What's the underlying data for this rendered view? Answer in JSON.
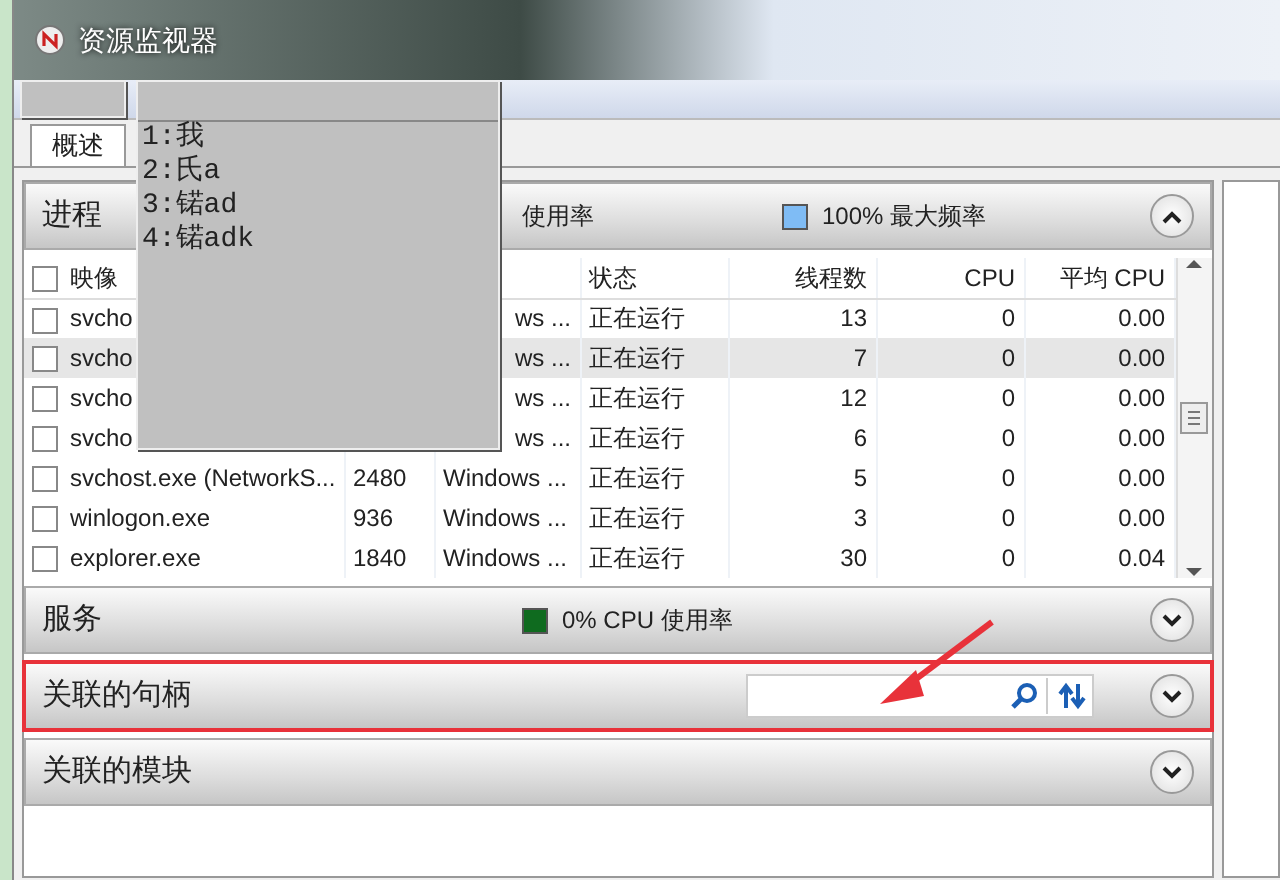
{
  "window": {
    "title": "资源监视器"
  },
  "tabs": [
    {
      "label": "概述",
      "selected": true
    }
  ],
  "ime_popup": {
    "candidates": [
      "1:我",
      "2:氏a",
      "3:锘ad",
      "4:锘adk"
    ]
  },
  "sections": [
    {
      "kind": "table",
      "title": "进程",
      "summary": "使用率",
      "indicator": "100% 最大频率",
      "color": "#7fbcf5",
      "expanded": true,
      "highlighted": false,
      "table": {
        "header_checked": false,
        "columns": [
          "映像",
          "",
          "",
          "状态",
          "线程数",
          "CPU",
          "平均 CPU"
        ],
        "rows": [
          {
            "image": "svcho",
            "description": "ws ...",
            "status": "正在运行",
            "threads": "13",
            "cpu": "0",
            "avg_cpu": "0.00",
            "checked": false,
            "selected": false
          },
          {
            "image": "svcho",
            "description": "ws ...",
            "status": "正在运行",
            "threads": "7",
            "cpu": "0",
            "avg_cpu": "0.00",
            "checked": false,
            "selected": true
          },
          {
            "image": "svcho",
            "description": "ws ...",
            "status": "正在运行",
            "threads": "12",
            "cpu": "0",
            "avg_cpu": "0.00",
            "checked": false,
            "selected": false
          },
          {
            "image": "svcho",
            "description": "ws ...",
            "status": "正在运行",
            "threads": "6",
            "cpu": "0",
            "avg_cpu": "0.00",
            "checked": false,
            "selected": false
          },
          {
            "image": "svchost.exe (NetworkS...",
            "pid": "2480",
            "description": "Windows ...",
            "status": "正在运行",
            "threads": "5",
            "cpu": "0",
            "avg_cpu": "0.00",
            "checked": false,
            "selected": false
          },
          {
            "image": "winlogon.exe",
            "pid": "936",
            "description": "Windows ...",
            "status": "正在运行",
            "threads": "3",
            "cpu": "0",
            "avg_cpu": "0.00",
            "checked": false,
            "selected": false
          },
          {
            "image": "explorer.exe",
            "pid": "1840",
            "description": "Windows ...",
            "status": "正在运行",
            "threads": "30",
            "cpu": "0",
            "avg_cpu": "0.04",
            "checked": false,
            "selected": false
          }
        ]
      }
    },
    {
      "kind": "plain",
      "title": "服务",
      "indicator": "0% CPU 使用率",
      "color": "#0f6b1f",
      "expanded": false,
      "highlighted": false
    },
    {
      "kind": "search",
      "title": "关联的句柄",
      "expanded": false,
      "highlighted": true
    },
    {
      "kind": "plain",
      "title": "关联的模块",
      "expanded": false,
      "highlighted": false
    }
  ]
}
